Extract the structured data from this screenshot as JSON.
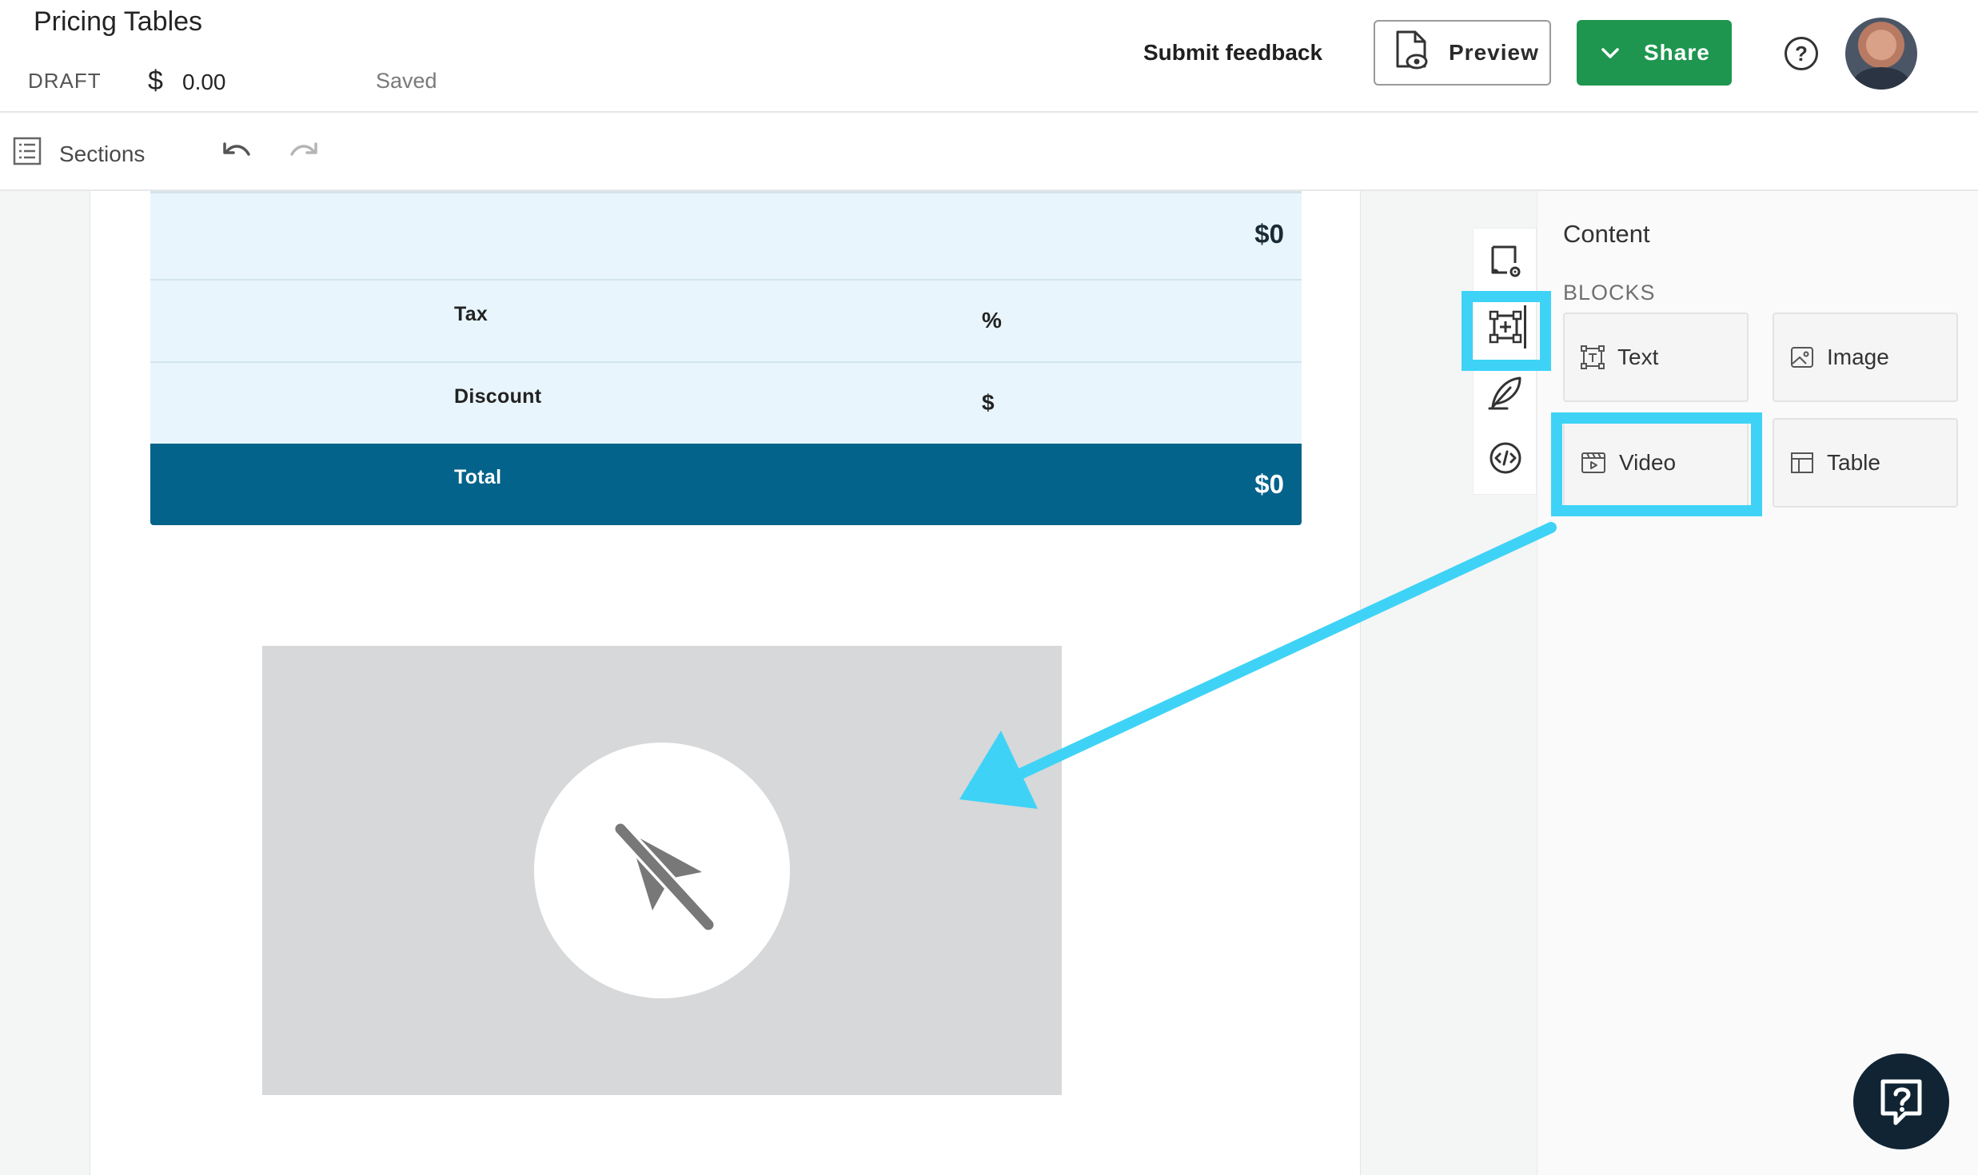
{
  "header": {
    "title": "Pricing Tables",
    "status": "DRAFT",
    "currency_symbol": "$",
    "amount": "0.00",
    "save_state": "Saved",
    "feedback_label": "Submit feedback",
    "preview_label": "Preview",
    "share_label": "Share"
  },
  "toolbar": {
    "sections_label": "Sections"
  },
  "pricing_table": {
    "subtotal_value": "$0",
    "rows": [
      {
        "label": "Tax",
        "unit": "%"
      },
      {
        "label": "Discount",
        "unit": "$"
      }
    ],
    "total_label": "Total",
    "total_value": "$0"
  },
  "panel": {
    "title": "Content",
    "section_label": "BLOCKS",
    "blocks": [
      {
        "label": "Text",
        "icon": "text-block-icon"
      },
      {
        "label": "Image",
        "icon": "image-block-icon"
      },
      {
        "label": "Video",
        "icon": "video-block-icon"
      },
      {
        "label": "Table",
        "icon": "table-block-icon"
      }
    ]
  },
  "colors": {
    "accent_highlight": "#3ed3f6",
    "share_green": "#1e9650",
    "total_row": "#03638a",
    "row_fill": "#e8f5fc"
  }
}
